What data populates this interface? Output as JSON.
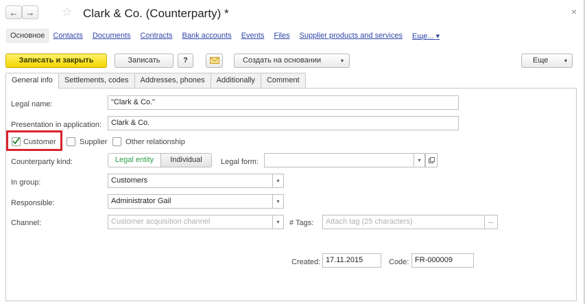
{
  "window": {
    "title": "Clark & Co. (Counterparty) *",
    "back_glyph": "←",
    "forward_glyph": "→",
    "star_glyph": "☆",
    "close_glyph": "×"
  },
  "sections": {
    "active": "Основное",
    "links": [
      "Contacts",
      "Documents",
      "Contracts",
      "Bank accounts",
      "Events",
      "Files",
      "Supplier products and services",
      "Еще... ▾"
    ]
  },
  "toolbar": {
    "save_close": "Записать и закрыть",
    "save": "Записать",
    "help": "?",
    "create_based": "Создать на основании",
    "more": "Еще",
    "dropdown_glyph": "▾"
  },
  "tabs": [
    "General info",
    "Settlements, codes",
    "Addresses, phones",
    "Additionally",
    "Comment"
  ],
  "form": {
    "legal_name_label": "Legal name:",
    "legal_name_value": "\"Clark & Co.\"",
    "presentation_label": "Presentation in application:",
    "presentation_value": "Clark & Co.",
    "customer_label": "Customer",
    "supplier_label": "Supplier",
    "other_label": "Other relationship",
    "kind_label": "Counterparty kind:",
    "kind_legal": "Legal entity",
    "kind_individual": "Individual",
    "legal_form_label": "Legal form:",
    "legal_form_value": "",
    "group_label": "In group:",
    "group_value": "Customers",
    "responsible_label": "Responsible:",
    "responsible_value": "Administrator Gail",
    "channel_label": "Channel:",
    "channel_placeholder": "Customer acquisition channel",
    "tags_label": "# Tags:",
    "tags_placeholder": "Attach tag (25 characters)",
    "tags_btn": "...",
    "created_label": "Created:",
    "created_value": "17.11.2015",
    "code_label": "Code:",
    "code_value": "FR-000009"
  },
  "colors": {
    "accent_yellow": "#f5d400",
    "highlight_red": "#d9232d",
    "link_blue": "#2f45a8",
    "check_green": "#2e8b3a",
    "legal_entity_green": "#2e9e4a"
  }
}
